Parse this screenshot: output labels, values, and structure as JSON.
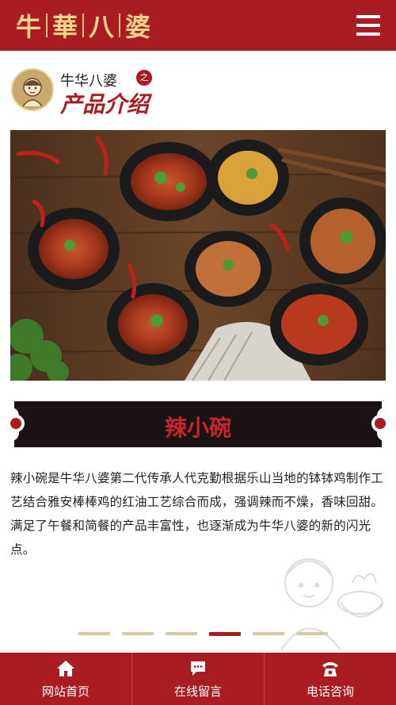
{
  "header": {
    "logo_chars": [
      "牛",
      "華",
      "八",
      "婆"
    ],
    "menu_icon": "hamburger-menu-icon"
  },
  "section": {
    "brand": "牛华八婆",
    "zhi": "之",
    "title": "产品介绍"
  },
  "product": {
    "name": "辣小碗",
    "description": "辣小碗是牛华八婆第二代传承人代克勤根据乐山当地的钵钵鸡制作工艺结合雅安棒棒鸡的红油工艺综合而成，强调辣而不燥，香味回甜。满足了午餐和简餐的产品丰富性，也逐渐成为牛华八婆的新的闪光点。"
  },
  "carousel": {
    "total": 6,
    "active_index": 3
  },
  "bottom_nav": [
    {
      "label": "网站首页",
      "icon": "home-icon"
    },
    {
      "label": "在线留言",
      "icon": "chat-bubble-icon"
    },
    {
      "label": "电话咨询",
      "icon": "telephone-icon"
    }
  ],
  "colors": {
    "brand_red": "#a81c22",
    "gold": "#f3d58a",
    "title_bar": "#1a1214"
  }
}
